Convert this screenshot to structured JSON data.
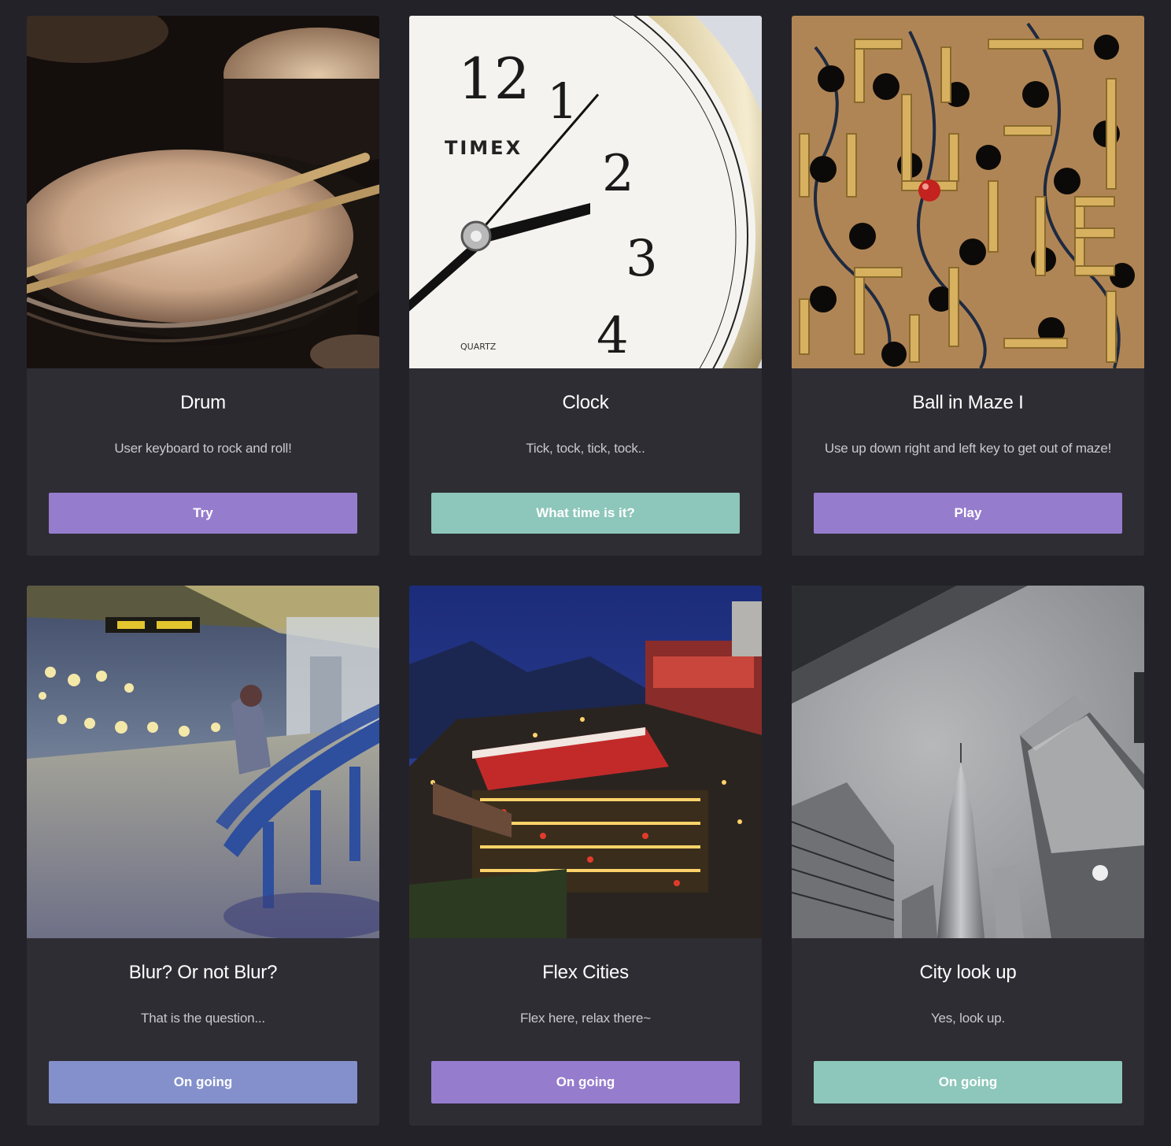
{
  "colors": {
    "background": "#232228",
    "card": "#2e2d33",
    "purple": "#967ccd",
    "teal": "#8dc6ba",
    "periwinkle": "#8390cb"
  },
  "cards": [
    {
      "title": "Drum",
      "description": "User keyboard to rock and roll!",
      "button_label": "Try",
      "button_color": "#967ccd",
      "image": "drum-kit-photo"
    },
    {
      "title": "Clock",
      "description": "Tick, tock, tick, tock..",
      "button_label": "What time is it?",
      "button_color": "#8dc6ba",
      "image": "timex-clock-photo",
      "image_text": {
        "brand": "TIMEX",
        "sub": "QUARTZ"
      }
    },
    {
      "title": "Ball in Maze I",
      "description": "Use up down right and left key to get out of maze!",
      "button_label": "Play",
      "button_color": "#967ccd",
      "image": "wooden-maze-photo"
    },
    {
      "title": "Blur? Or not Blur?",
      "description": "That is the question...",
      "button_label": "On going",
      "button_color": "#8390cb",
      "image": "train-platform-bench-photo"
    },
    {
      "title": "Flex Cities",
      "description": "Flex here, relax there~",
      "button_label": "On going",
      "button_color": "#967ccd",
      "image": "night-town-photo"
    },
    {
      "title": "City look up",
      "description": "Yes, look up.",
      "button_label": "On going",
      "button_color": "#8dc6ba",
      "image": "skyscrapers-photo"
    }
  ]
}
